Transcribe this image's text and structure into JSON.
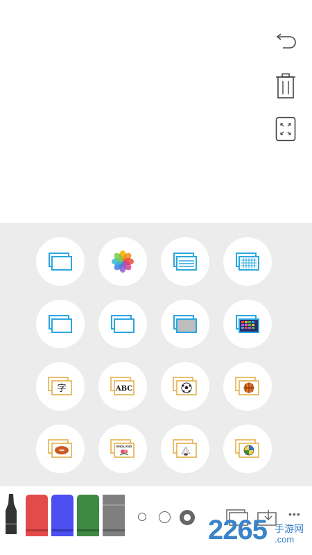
{
  "colors": {
    "panel_bg": "#ececec",
    "accent_blue": "#2aa7df",
    "pen_red": "#e34b4b",
    "pen_blue": "#4b4ef0",
    "pen_green": "#3e8a45",
    "pen_gray": "#7f7f7f",
    "marker_black": "#333333",
    "watermark": "#3a83c8"
  },
  "toolbar": {
    "icons": [
      "undo-icon",
      "trash-icon",
      "fullscreen-icon"
    ]
  },
  "picker": {
    "rows": [
      [
        "blank-board",
        "photos",
        "lined-board",
        "grid-board"
      ],
      [
        "blank-board-wide",
        "blank-board-light",
        "gray-board",
        "color-grid-board"
      ],
      [
        "chinese-character-card",
        "abc-card",
        "soccer-card",
        "basketball-card"
      ],
      [
        "rugby-card",
        "england-card",
        "badminton-card",
        "volleyball-card"
      ]
    ],
    "labels": {
      "char": "字",
      "abc": "ABC",
      "england": "ENGLAND"
    }
  },
  "bottom_bar": {
    "pens": [
      "marker-black",
      "pen-red",
      "pen-blue",
      "pen-green",
      "pen-gray"
    ],
    "page_dots": 3,
    "active_page": 3,
    "more": "•••"
  },
  "watermark": {
    "number": "2265",
    "suffix": ".com",
    "cn": "手游网"
  }
}
